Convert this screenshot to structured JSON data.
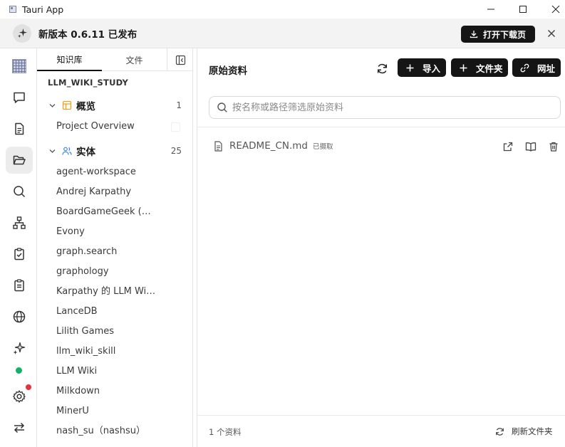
{
  "window": {
    "title": "Tauri App"
  },
  "banner": {
    "text": "新版本 0.6.11 已发布",
    "download_label": "打开下载页"
  },
  "sidebar": {
    "tabs": [
      {
        "label": "知识库",
        "active": true
      },
      {
        "label": "文件",
        "active": false
      }
    ],
    "project_name": "LLM_WIKI_STUDY",
    "groups": [
      {
        "label": "概览",
        "count": "1",
        "items": [
          "Project Overview"
        ]
      },
      {
        "label": "实体",
        "count": "25",
        "items": [
          "agent-workspace",
          "Andrej Karpathy",
          "BoardGameGeek (BoardGameGeek)",
          "Evony",
          "graph.search",
          "graphology",
          "Karpathy 的 LLM Wiki 方法",
          "LanceDB",
          "Lilith Games",
          "llm_wiki_skill",
          "LLM Wiki",
          "Milkdown",
          "MinerU",
          "nash_su（nashsu）"
        ]
      }
    ]
  },
  "main": {
    "title": "原始资料",
    "buttons": {
      "import": "导入",
      "folder": "文件夹",
      "url": "网址"
    },
    "search_placeholder": "按名称或路径筛选原始资料",
    "files": [
      {
        "name": "README_CN.md",
        "status": "已摄取"
      }
    ],
    "footer": {
      "count": "1 个资料",
      "refresh": "刷新文件夹"
    }
  },
  "colors": {
    "accent_dark": "#151515",
    "status_online": "#14b06a",
    "notification": "#e5323c",
    "tree_icon_orange": "#f0a020",
    "tree_icon_blue": "#3b82f6"
  }
}
